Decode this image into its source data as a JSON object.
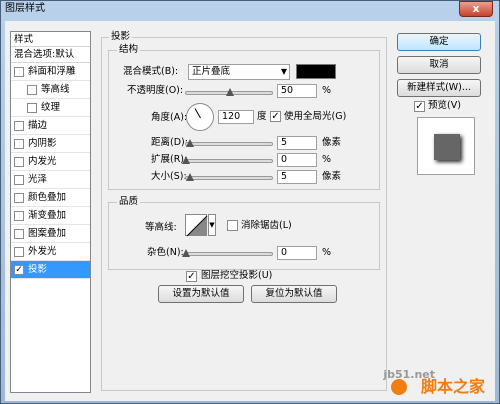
{
  "window": {
    "title": "图层样式",
    "close": "x"
  },
  "sidebar": {
    "header": "样式",
    "blend_options": "混合选项:默认",
    "items": [
      {
        "label": "斜面和浮雕",
        "checked": false,
        "sub": false
      },
      {
        "label": "等高线",
        "checked": false,
        "sub": true
      },
      {
        "label": "纹理",
        "checked": false,
        "sub": true
      },
      {
        "label": "描边",
        "checked": false,
        "sub": false
      },
      {
        "label": "内阴影",
        "checked": false,
        "sub": false
      },
      {
        "label": "内发光",
        "checked": false,
        "sub": false
      },
      {
        "label": "光泽",
        "checked": false,
        "sub": false
      },
      {
        "label": "颜色叠加",
        "checked": false,
        "sub": false
      },
      {
        "label": "渐变叠加",
        "checked": false,
        "sub": false
      },
      {
        "label": "图案叠加",
        "checked": false,
        "sub": false
      },
      {
        "label": "外发光",
        "checked": false,
        "sub": false
      },
      {
        "label": "投影",
        "checked": true,
        "sub": false,
        "active": true
      }
    ]
  },
  "panel": {
    "title": "投影",
    "structure": {
      "legend": "结构",
      "blend_mode_label": "混合模式(B):",
      "blend_mode_value": "正片叠底",
      "shadow_color": "#000000",
      "opacity_label": "不透明度(O):",
      "opacity_value": "50",
      "opacity_unit": "%",
      "angle_label": "角度(A):",
      "angle_value": "120",
      "angle_unit": "度",
      "global_light_label": "使用全局光(G)",
      "global_light_checked": true,
      "distance_label": "距离(D):",
      "distance_value": "5",
      "distance_unit": "像素",
      "spread_label": "扩展(R):",
      "spread_value": "0",
      "spread_unit": "%",
      "size_label": "大小(S):",
      "size_value": "5",
      "size_unit": "像素"
    },
    "quality": {
      "legend": "品质",
      "contour_label": "等高线:",
      "antialias_label": "消除锯齿(L)",
      "antialias_checked": false,
      "noise_label": "杂色(N):",
      "noise_value": "0",
      "noise_unit": "%"
    },
    "knockout_label": "图层挖空投影(U)",
    "knockout_checked": true,
    "make_default_label": "设置为默认值",
    "reset_default_label": "复位为默认值"
  },
  "actions": {
    "ok_label": "确定",
    "cancel_label": "取消",
    "new_style_label": "新建样式(W)...",
    "preview_label": "预览(V)",
    "preview_checked": true
  },
  "watermark": {
    "site": "jb51.net",
    "name": "脚本之家"
  }
}
